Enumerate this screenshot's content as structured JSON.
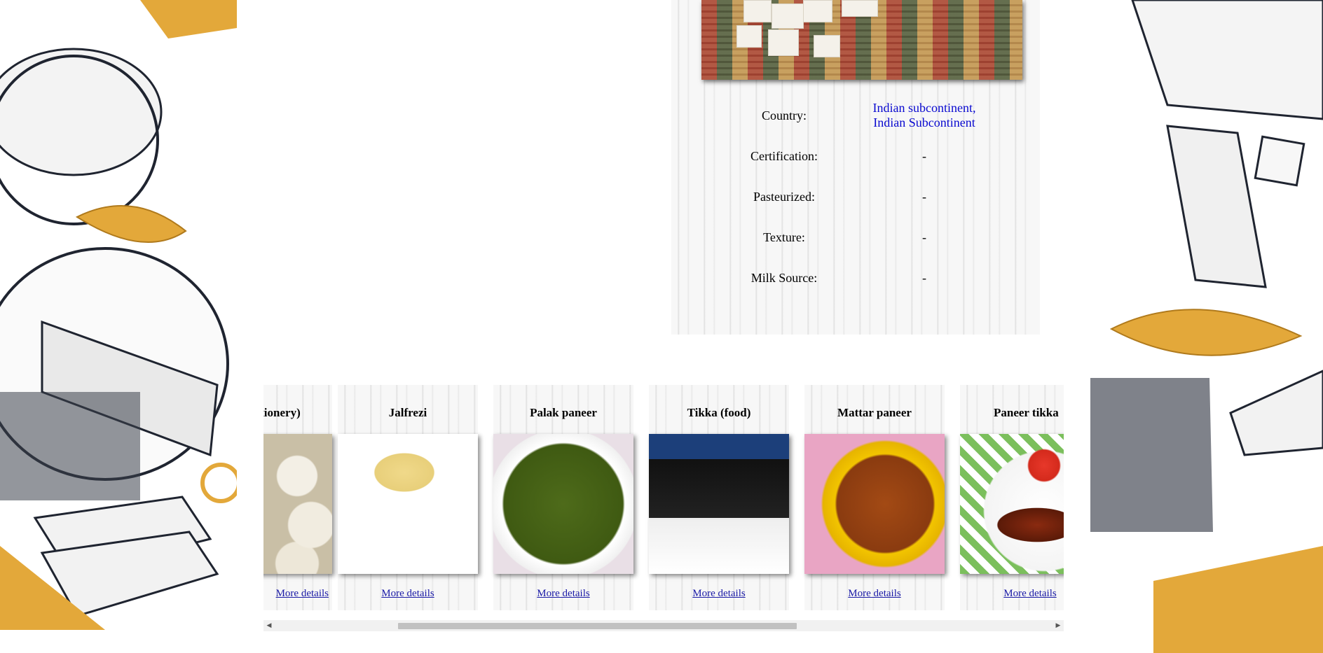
{
  "details": {
    "rows": [
      {
        "label": "Country:",
        "value_lines": [
          "Indian subcontinent,",
          "Indian Subcontinent"
        ],
        "is_link": true
      },
      {
        "label": "Certification:",
        "value_lines": [
          "-"
        ],
        "is_link": false
      },
      {
        "label": "Pasteurized:",
        "value_lines": [
          "-"
        ],
        "is_link": false
      },
      {
        "label": "Texture:",
        "value_lines": [
          "-"
        ],
        "is_link": false
      },
      {
        "label": "Milk Source:",
        "value_lines": [
          "-"
        ],
        "is_link": false
      }
    ]
  },
  "carousel": {
    "more_label": "More details",
    "cards": [
      {
        "title": "(confectionery)",
        "image": "dumplings-photo"
      },
      {
        "title": "Jalfrezi",
        "image": "jalfrezi-photo"
      },
      {
        "title": "Palak paneer",
        "image": "palak-paneer-photo"
      },
      {
        "title": "Tikka (food)",
        "image": "tikka-photo"
      },
      {
        "title": "Mattar paneer",
        "image": "mattar-paneer-photo"
      },
      {
        "title": "Paneer tikka",
        "image": "paneer-tikka-photo"
      }
    ],
    "scroll_left_icon": "triangle-left-icon",
    "scroll_right_icon": "triangle-right-icon"
  },
  "colors": {
    "link": "#0a0ad0",
    "accent_gold": "#e0a832",
    "ink": "#1f2430"
  }
}
